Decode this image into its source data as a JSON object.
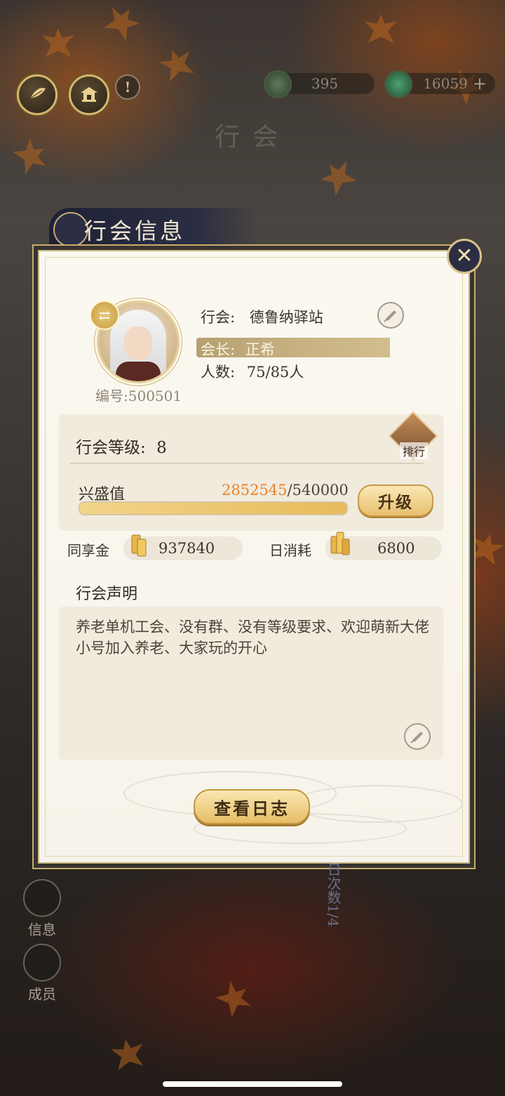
{
  "header": {
    "currency_a": "395",
    "currency_b": "16059",
    "plus": "+",
    "title": "行会",
    "info": "!"
  },
  "panel": {
    "title": "行会信息",
    "close": "✕"
  },
  "guild": {
    "name_label": "行会:",
    "name": "德鲁纳驿站",
    "leader_label": "会长:",
    "leader": "正希",
    "members_label": "人数:",
    "members": "75/85人",
    "id_label": "编号:",
    "id": "500501"
  },
  "level": {
    "label": "行会等级:",
    "value": "8",
    "rank_label": "排行",
    "prosperity_label": "兴盛值",
    "prosperity_current": "2852545",
    "prosperity_max": "/540000",
    "prosperity_fill": 1.0,
    "upgrade_label": "升级"
  },
  "funds": {
    "shared_label": "同享金",
    "shared_value": "937840",
    "daily_label": "日消耗",
    "daily_value": "6800"
  },
  "declaration": {
    "label": "行会声明",
    "text": "养老单机工会、没有群、没有等级要求、欢迎萌新大佬小号加入养老、大家玩的开心"
  },
  "log_button": "查看日志",
  "side_nav": [
    {
      "label": "信息"
    },
    {
      "label": "成员"
    }
  ],
  "background_vertical_text": "日次数1/4",
  "colors": {
    "accent_gold": "#e7bb5a",
    "prosperity_current": "#e8842e",
    "panel_bg": "#fbf8f0",
    "tab_navy": "#2b2d42"
  }
}
